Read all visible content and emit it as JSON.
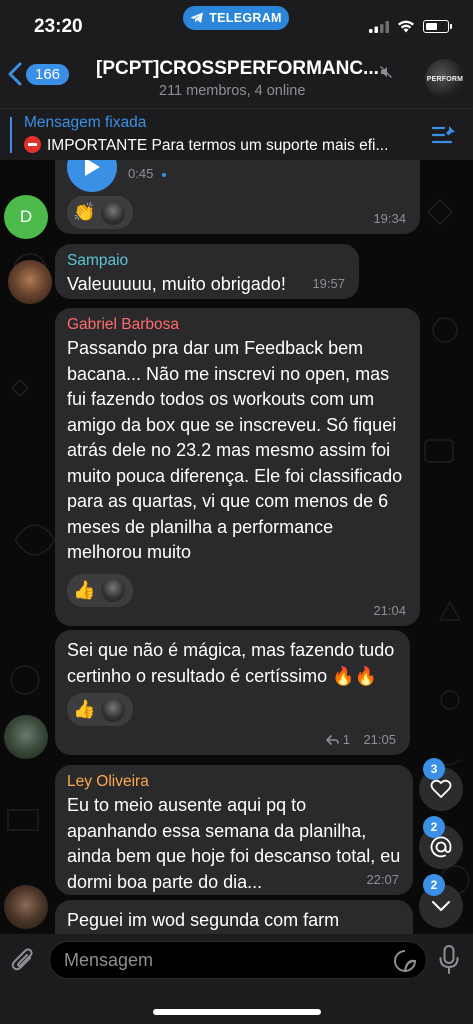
{
  "status": {
    "time": "23:20",
    "app_pill": "TELEGRAM"
  },
  "header": {
    "back_count": "166",
    "title": "[PCPT]CROSSPERFORMANC...",
    "subtitle": "211 membros, 4 online",
    "avatar_text": "PERFORM"
  },
  "pinned": {
    "label": "Mensagem fixada",
    "text": "IMPORTANTE Para termos um suporte mais efi..."
  },
  "messages": [
    {
      "voice_duration": "0:45",
      "time": "19:34",
      "avatar_letter": "D",
      "reactions": [
        "👏"
      ]
    },
    {
      "sender": "Sampaio",
      "sender_color": "#5ac8d8",
      "text": "Valeuuuuu, muito obrigado!",
      "time": "19:57"
    },
    {
      "sender": "Gabriel Barbosa",
      "sender_color": "#ff6b6b",
      "text": "Passando pra dar um Feedback bem bacana... Não me inscrevi no open, mas fui fazendo todos os workouts com um amigo da box que se inscreveu. Só fiquei atrás dele no 23.2 mas mesmo assim foi muito pouca diferença. Ele foi classificado para as quartas, vi que com menos de 6 meses de planilha a performance melhorou muito",
      "time": "21:04",
      "reactions": [
        "👍"
      ]
    },
    {
      "text": "Sei que não é mágica, mas fazendo tudo certinho o resultado é certíssimo 🔥🔥",
      "time": "21:05",
      "replies": "1",
      "reactions": [
        "👍"
      ]
    },
    {
      "sender": "Ley Oliveira",
      "sender_color": "#ffa94d",
      "text": "Eu to meio ausente aqui pq to apanhando essa semana da planilha, ainda bem que hoje foi descanso total, eu dormi boa parte do dia...",
      "time": "22:07"
    },
    {
      "text": "Peguei im wod segunda com farm"
    }
  ],
  "floating": {
    "reactions_count": "3",
    "mentions_count": "2",
    "unread_count": "2"
  },
  "input": {
    "placeholder": "Mensagem"
  }
}
